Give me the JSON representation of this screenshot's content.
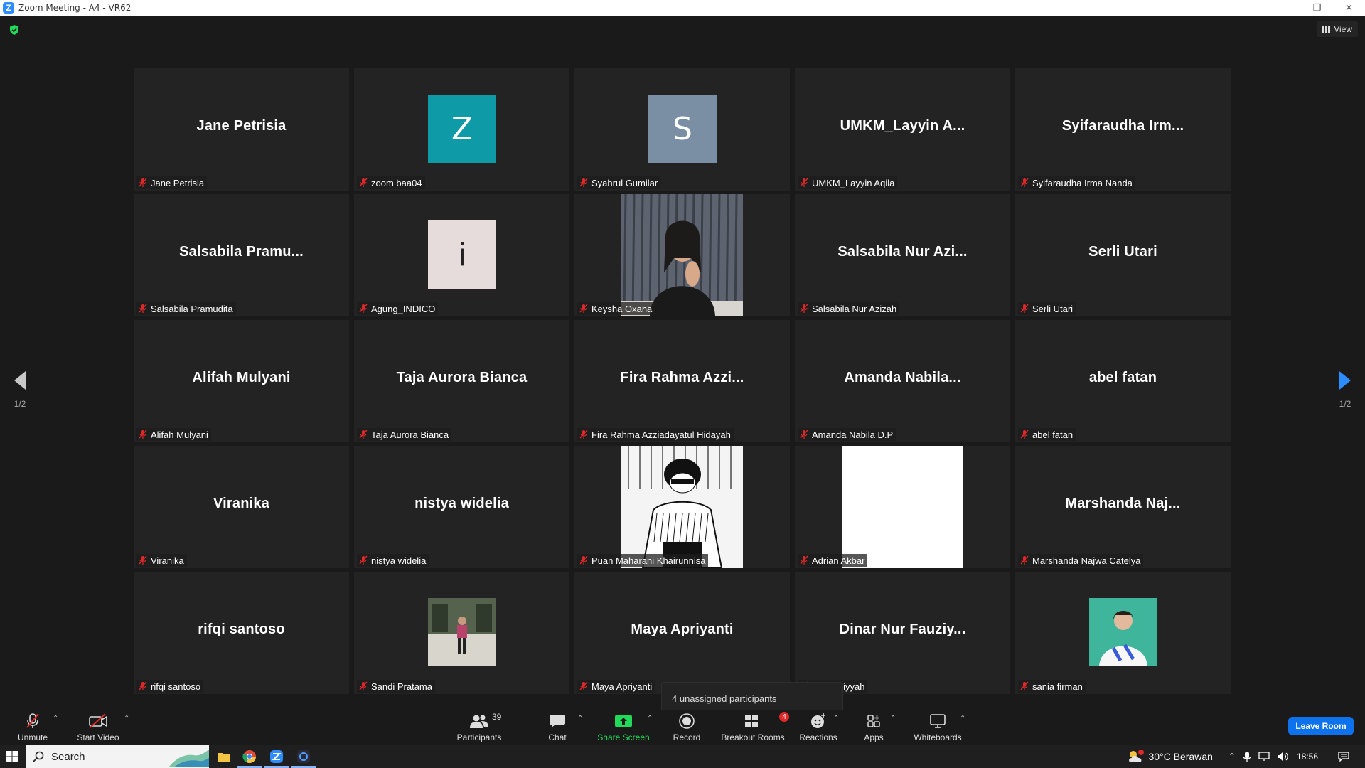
{
  "window": {
    "title": "Zoom Meeting - A4 - VR62"
  },
  "view": {
    "label": "View"
  },
  "pager": {
    "left": "1/2",
    "right": "1/2"
  },
  "tiles": [
    {
      "big": "Jane Petrisia",
      "label": "Jane Petrisia"
    },
    {
      "avatar": "Z",
      "avatar_color": "#0e9aa7",
      "label": "zoom baa04"
    },
    {
      "avatar": "S",
      "avatar_color": "#7a8fa3",
      "label": "Syahrul Gumilar"
    },
    {
      "big": "UMKM_Layyin  A...",
      "label": "UMKM_Layyin Aqila"
    },
    {
      "big": "Syifaraudha  Irm...",
      "label": "Syifaraudha Irma Nanda"
    },
    {
      "big": "Salsabila  Pramu...",
      "label": "Salsabila Pramudita"
    },
    {
      "avatar": "i",
      "avatar_color": "#e7dcdc",
      "label": "Agung_INDICO"
    },
    {
      "photo": "keysha",
      "label": "Keysha Oxana"
    },
    {
      "big": "Salsabila  Nur  Azi...",
      "label": "Salsabila Nur Azizah"
    },
    {
      "big": "Serli Utari",
      "label": "Serli Utari"
    },
    {
      "big": "Alifah Mulyani",
      "label": "Alifah Mulyani"
    },
    {
      "big": "Taja Aurora Bianca",
      "label": "Taja Aurora Bianca"
    },
    {
      "big": "Fira  Rahma  Azzi...",
      "label": "Fira Rahma Azziadayatul Hidayah"
    },
    {
      "big": "Amanda  Nabila...",
      "label": "Amanda Nabila D.P"
    },
    {
      "big": "abel fatan",
      "label": "abel fatan"
    },
    {
      "big": "Viranika",
      "label": "Viranika"
    },
    {
      "big": "nistya widelia",
      "label": "nistya widelia"
    },
    {
      "photo": "manga",
      "label": "Puan Maharani Khairunnisa"
    },
    {
      "photo": "white",
      "label": "Adrian Akbar"
    },
    {
      "big": "Marshanda  Naj...",
      "label": "Marshanda Najwa Catelya"
    },
    {
      "big": "rifqi santoso",
      "label": "rifqi santoso"
    },
    {
      "small_photo": "street",
      "label": "Sandi Pratama"
    },
    {
      "big": "Maya Apriyanti",
      "label": "Maya Apriyanti"
    },
    {
      "big": "Dinar  Nur  Fauziy...",
      "label": "ur Fauziyyah"
    },
    {
      "small_photo": "teal",
      "label": "sania firman"
    }
  ],
  "tooltip": {
    "text": "4 unassigned participants"
  },
  "toolbar": {
    "unmute": "Unmute",
    "start_video": "Start Video",
    "participants": "Participants",
    "participants_count": "39",
    "chat": "Chat",
    "share_screen": "Share Screen",
    "record": "Record",
    "breakout_rooms": "Breakout Rooms",
    "breakout_badge": "4",
    "reactions": "Reactions",
    "apps": "Apps",
    "whiteboards": "Whiteboards",
    "leave_room": "Leave Room"
  },
  "taskbar": {
    "search": "Search",
    "weather": "30°C  Berawan",
    "time": "18:56"
  },
  "colors": {
    "share_green": "#23d959",
    "leave_blue": "#0e72ed",
    "mute_red": "#e02828"
  }
}
